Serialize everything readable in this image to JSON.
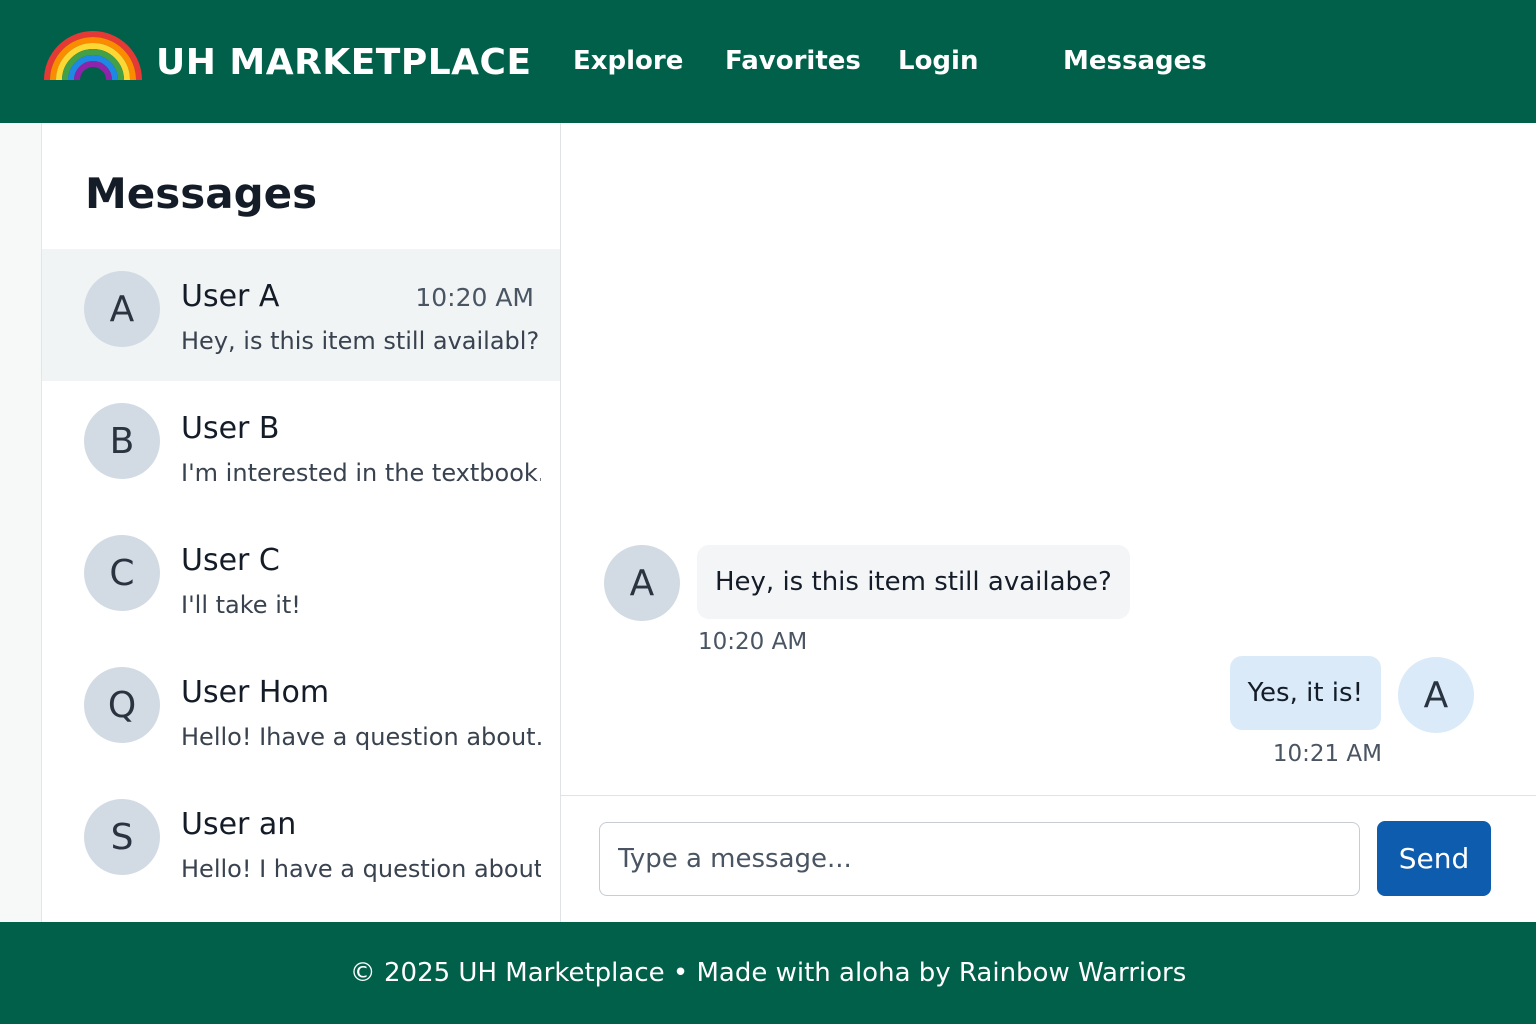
{
  "header": {
    "brand": "UH MARKETPLACE",
    "logo_icon": "rainbow-icon",
    "nav": [
      {
        "label": "Explore"
      },
      {
        "label": "Favorites"
      },
      {
        "label": "Login"
      },
      {
        "label": "Messages"
      }
    ],
    "colors": {
      "bar": "#01604a"
    }
  },
  "sidebar": {
    "title": "Messages",
    "conversations": [
      {
        "initial": "A",
        "name": "User A",
        "time": "10:20 AM",
        "preview": "Hey, is this item still availabl?",
        "active": true
      },
      {
        "initial": "B",
        "name": "User B",
        "time": "",
        "preview": "I'm interested in the textbook..."
      },
      {
        "initial": "C",
        "name": "User C",
        "time": "",
        "preview": "I'll take it!"
      },
      {
        "initial": "Q",
        "name": "User Hom",
        "time": "",
        "preview": "Hello! Ihave a question about..."
      },
      {
        "initial": "S",
        "name": "User an",
        "time": "",
        "preview": "Hello! I have a question about..."
      }
    ]
  },
  "chat": {
    "messages": [
      {
        "from": "them",
        "initial": "A",
        "text": "Hey, is this item still availabe?",
        "time": "10:20 AM"
      },
      {
        "from": "me",
        "initial": "A",
        "text": "Yes, it is!",
        "time": "10:21 AM"
      }
    ],
    "composer": {
      "placeholder": "Type a message...",
      "send_label": "Send"
    },
    "colors": {
      "incoming_bubble": "#f4f5f7",
      "outgoing_bubble": "#daeaf9",
      "send_button": "#0d5cad"
    }
  },
  "footer": {
    "text": "© 2025 UH Marketplace • Made with aloha by Rainbow Warriors"
  }
}
